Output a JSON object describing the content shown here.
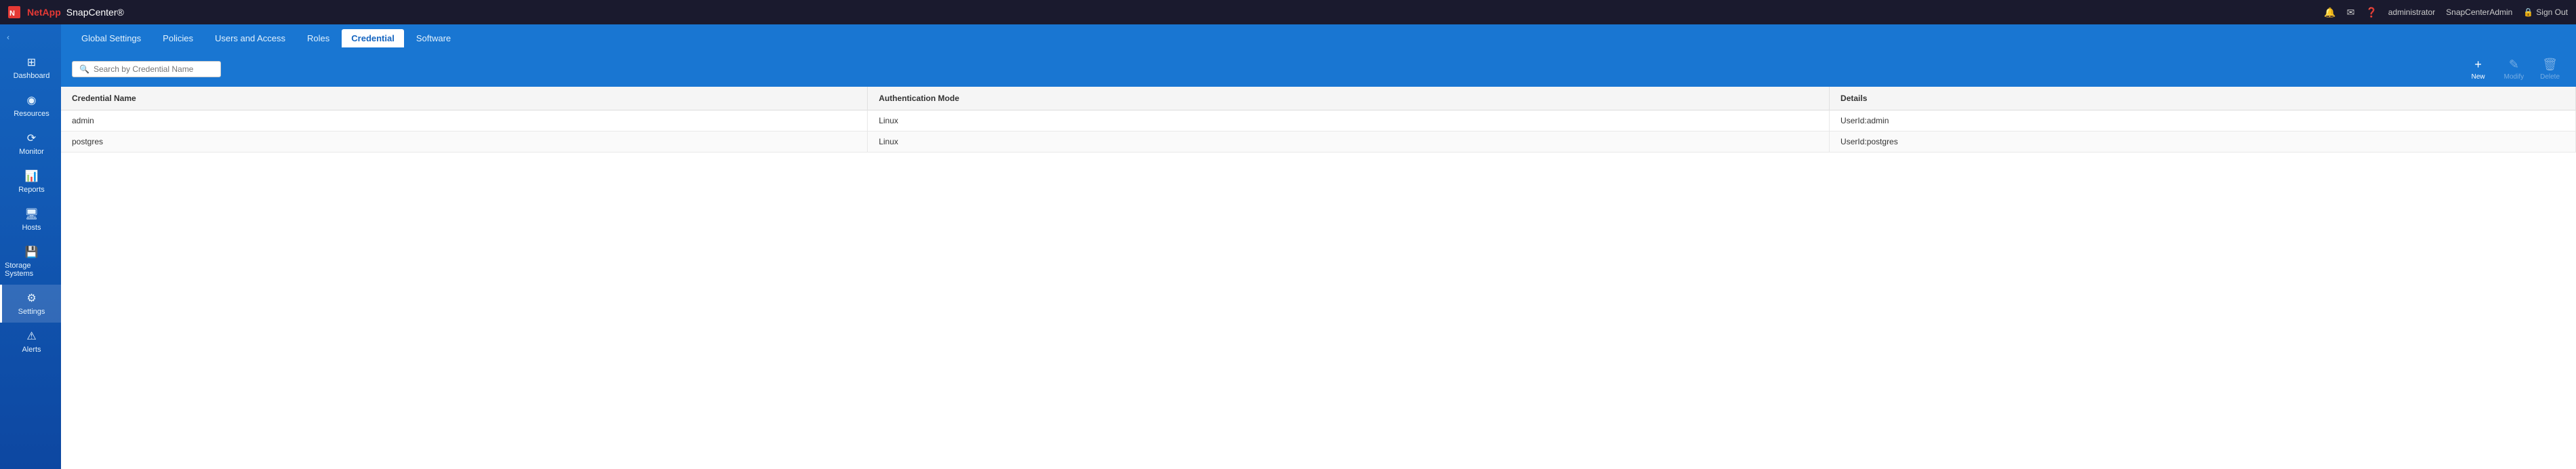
{
  "topbar": {
    "logo": "NetApp",
    "appname": "SnapCenter®",
    "icons": {
      "bell": "🔔",
      "mail": "✉",
      "help": "❓"
    },
    "user": "administrator",
    "adminLabel": "SnapCenterAdmin",
    "signout": "Sign Out"
  },
  "sidebar": {
    "collapse_icon": "‹",
    "items": [
      {
        "id": "dashboard",
        "label": "Dashboard",
        "icon": "⊞"
      },
      {
        "id": "resources",
        "label": "Resources",
        "icon": "◉"
      },
      {
        "id": "monitor",
        "label": "Monitor",
        "icon": "⟳"
      },
      {
        "id": "reports",
        "label": "Reports",
        "icon": "📊"
      },
      {
        "id": "hosts",
        "label": "Hosts",
        "icon": "🖥"
      },
      {
        "id": "storage-systems",
        "label": "Storage Systems",
        "icon": "💾"
      },
      {
        "id": "settings",
        "label": "Settings",
        "icon": "⚙"
      },
      {
        "id": "alerts",
        "label": "Alerts",
        "icon": "⚠"
      }
    ]
  },
  "subnav": {
    "items": [
      {
        "id": "global-settings",
        "label": "Global Settings"
      },
      {
        "id": "policies",
        "label": "Policies"
      },
      {
        "id": "users-and-access",
        "label": "Users and Access"
      },
      {
        "id": "roles",
        "label": "Roles"
      },
      {
        "id": "credential",
        "label": "Credential"
      },
      {
        "id": "software",
        "label": "Software"
      }
    ],
    "active": "credential"
  },
  "toolbar": {
    "search_placeholder": "Search by Credential Name",
    "actions": {
      "new_label": "New",
      "new_icon": "+",
      "modify_label": "Modify",
      "modify_icon": "✎",
      "delete_label": "Delete",
      "delete_icon": "🗑"
    }
  },
  "table": {
    "columns": [
      {
        "id": "credential-name",
        "label": "Credential Name"
      },
      {
        "id": "auth-mode",
        "label": "Authentication Mode"
      },
      {
        "id": "details",
        "label": "Details"
      }
    ],
    "rows": [
      {
        "credential_name": "admin",
        "auth_mode": "Linux",
        "details": "UserId:admin"
      },
      {
        "credential_name": "postgres",
        "auth_mode": "Linux",
        "details": "UserId:postgres"
      }
    ]
  }
}
